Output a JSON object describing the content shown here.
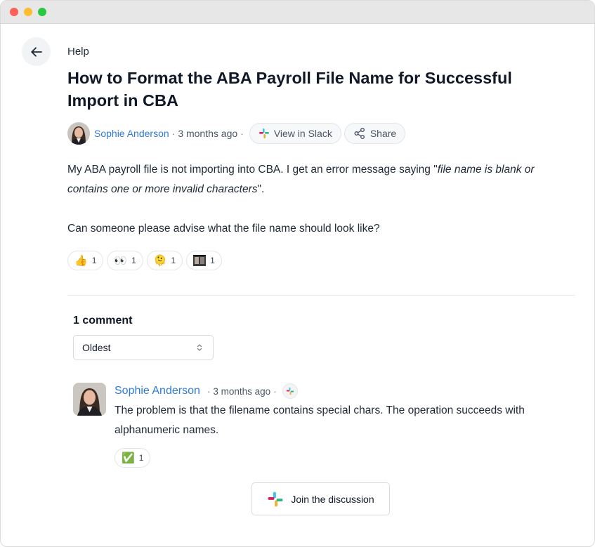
{
  "nav": {
    "breadcrumb": "Help",
    "back_icon": "arrow-left-icon"
  },
  "post": {
    "title": "How to Format the ABA Payroll File Name for Successful Import in CBA",
    "author": "Sophie Anderson",
    "time": "3 months ago",
    "view_in_slack_label": "View in Slack",
    "share_label": "Share",
    "body_p1_start": "My ABA payroll file is not importing into CBA. I get an error message saying \"",
    "body_p1_em": "file name is blank or contains one or more invalid characters",
    "body_p1_end": "\".",
    "body_p2": "Can someone please advise what the file name should look like?",
    "reactions": [
      {
        "emoji": "👍",
        "count": "1"
      },
      {
        "emoji": "👀",
        "count": "1"
      },
      {
        "emoji": "🫠",
        "count": "1"
      },
      {
        "emoji": "custom-image-emoji",
        "count": "1"
      }
    ]
  },
  "comments": {
    "heading": "1 comment",
    "sort_value": "Oldest",
    "items": [
      {
        "author": "Sophie Anderson",
        "time": "3 months ago",
        "text": "The problem is that the filename contains special chars. The operation succeeds with alphanumeric names.",
        "reaction": {
          "emoji": "✅",
          "count": "1"
        }
      }
    ]
  },
  "join_label": "Join the discussion",
  "colors": {
    "link": "#2f7bd8",
    "border": "#e2e5ea"
  }
}
